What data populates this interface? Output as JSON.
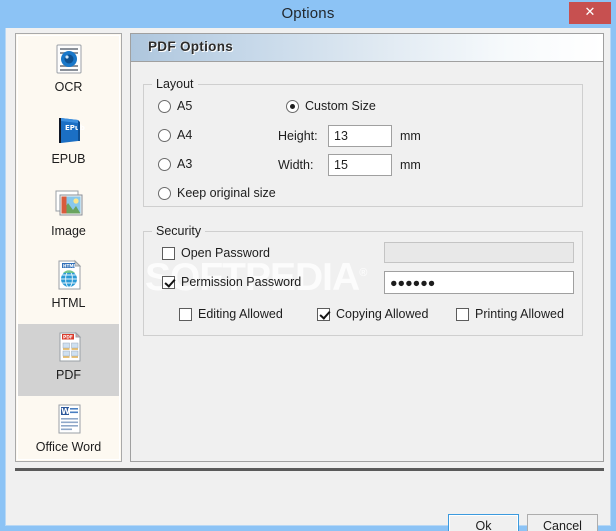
{
  "window": {
    "title": "Options",
    "close_icon": "close-icon",
    "close_label": "✕"
  },
  "sidebar": {
    "items": [
      {
        "id": "ocr",
        "label": "OCR",
        "icon": "ocr-icon",
        "selected": false
      },
      {
        "id": "epub",
        "label": "EPUB",
        "icon": "epub-book-icon",
        "selected": false
      },
      {
        "id": "image",
        "label": "Image",
        "icon": "image-icon",
        "selected": false
      },
      {
        "id": "html",
        "label": "HTML",
        "icon": "html-globe-icon",
        "selected": false
      },
      {
        "id": "pdf",
        "label": "PDF",
        "icon": "pdf-file-icon",
        "selected": true
      },
      {
        "id": "officeword",
        "label": "Office Word",
        "icon": "word-doc-icon",
        "selected": false
      }
    ]
  },
  "main": {
    "header": "PDF Options",
    "layout": {
      "legend": "Layout",
      "radios": [
        {
          "id": "a5",
          "label": "A5",
          "checked": false
        },
        {
          "id": "a4",
          "label": "A4",
          "checked": false
        },
        {
          "id": "a3",
          "label": "A3",
          "checked": false
        },
        {
          "id": "keeporig",
          "label": "Keep original size",
          "checked": false
        },
        {
          "id": "custom",
          "label": "Custom Size",
          "checked": true
        }
      ],
      "height_label": "Height:",
      "height_value": "13",
      "height_unit": "mm",
      "width_label": "Width:",
      "width_value": "15",
      "width_unit": "mm"
    },
    "security": {
      "legend": "Security",
      "open_password": {
        "label": "Open Password",
        "checked": false,
        "value": "",
        "placeholder": "",
        "enabled": false
      },
      "permission_password": {
        "label": "Permission Password",
        "checked": true,
        "value": "●●●●●●",
        "placeholder": "",
        "enabled": true
      },
      "permissions": [
        {
          "id": "editing",
          "label": "Editing Allowed",
          "checked": false
        },
        {
          "id": "copying",
          "label": "Copying Allowed",
          "checked": true
        },
        {
          "id": "printing",
          "label": "Printing Allowed",
          "checked": false
        }
      ]
    }
  },
  "watermark": {
    "text": "SOFTPEDIA",
    "mark": "®"
  },
  "footer": {
    "ok_label": "Ok",
    "cancel_label": "Cancel"
  },
  "colors": {
    "window_frame": "#8cc3f5",
    "close_button": "#c75050",
    "client_bg": "#f0f0f0",
    "sidebar_bg": "#fdf9f1",
    "sidebar_selected": "#d2d2d2",
    "header_gradient_start": "#aec6dd",
    "accent_focus": "#3c9ade"
  }
}
